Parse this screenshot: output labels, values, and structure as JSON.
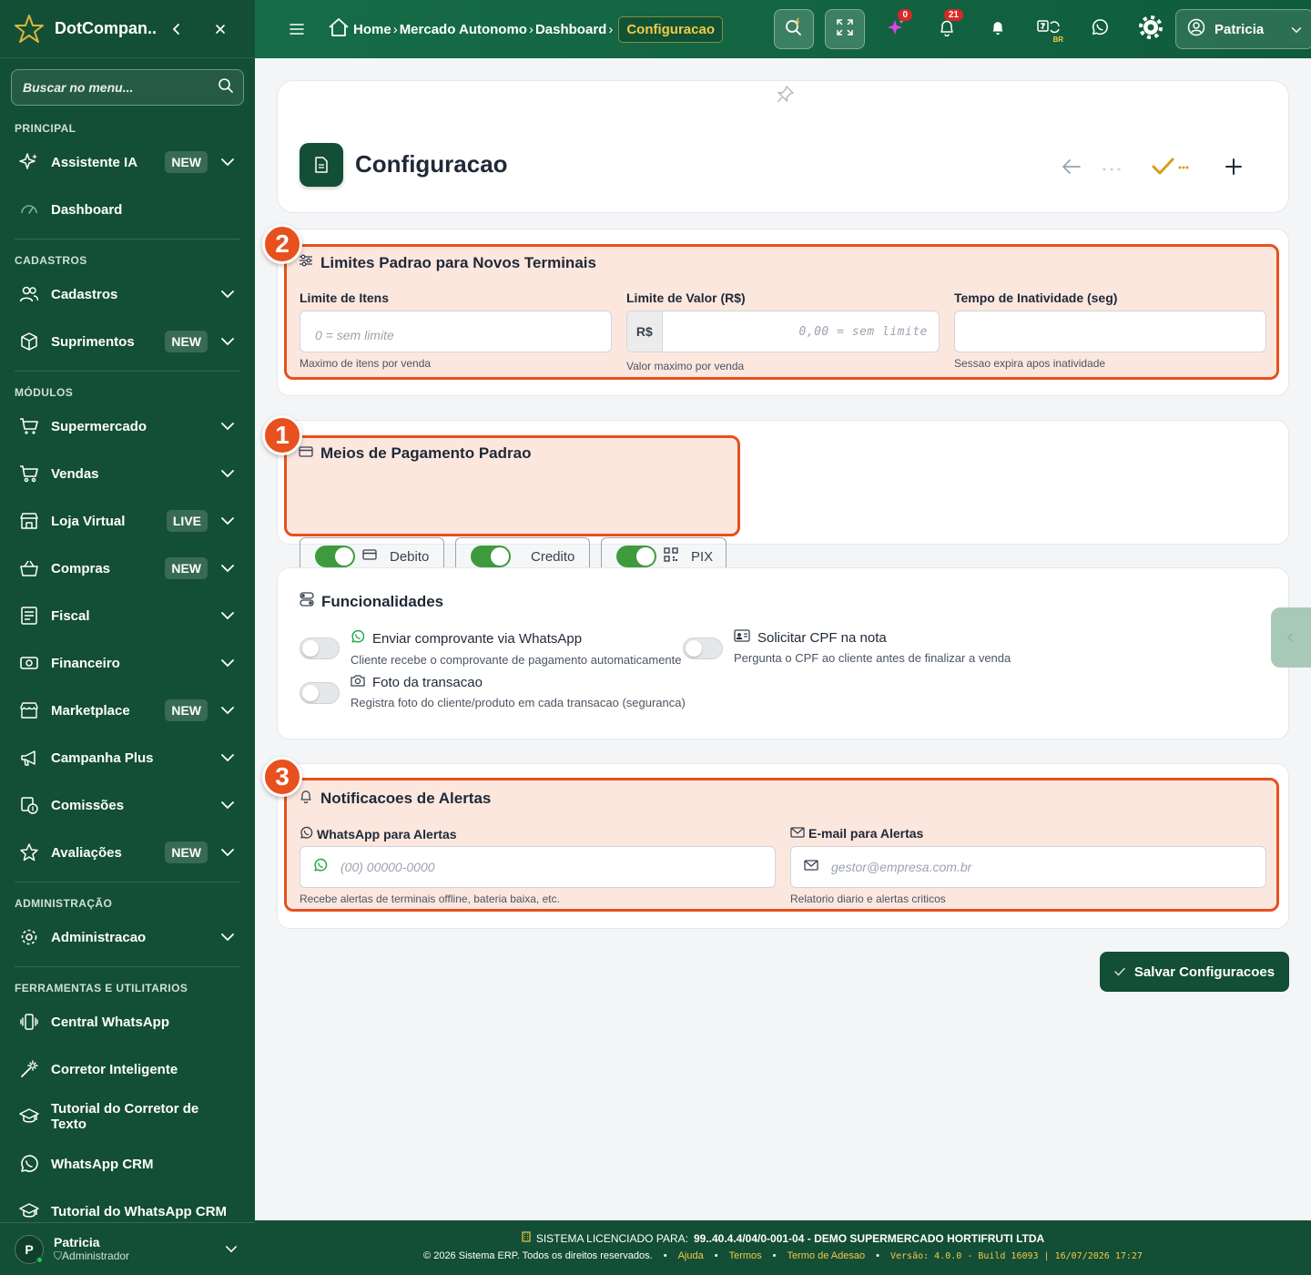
{
  "brand": {
    "name": "DotCompan..."
  },
  "sidebar": {
    "search_placeholder": "Buscar no menu...",
    "sections": {
      "principal": "PRINCIPAL",
      "cadastros": "CADASTROS",
      "modulos": "MÓDULOS",
      "administracao": "ADMINISTRAÇÃO",
      "ferramentas": "FERRAMENTAS E UTILITARIOS"
    },
    "items": {
      "assistente": {
        "label": "Assistente IA",
        "badge": "NEW"
      },
      "dashboard": {
        "label": "Dashboard"
      },
      "cadastros": {
        "label": "Cadastros"
      },
      "suprimentos": {
        "label": "Suprimentos",
        "badge": "NEW"
      },
      "supermercado": {
        "label": "Supermercado"
      },
      "vendas": {
        "label": "Vendas"
      },
      "loja": {
        "label": "Loja Virtual",
        "badge": "LIVE"
      },
      "compras": {
        "label": "Compras",
        "badge": "NEW"
      },
      "fiscal": {
        "label": "Fiscal"
      },
      "financeiro": {
        "label": "Financeiro"
      },
      "marketplace": {
        "label": "Marketplace",
        "badge": "NEW"
      },
      "campanha": {
        "label": "Campanha Plus"
      },
      "comissoes": {
        "label": "Comissões"
      },
      "avaliacoes": {
        "label": "Avaliações",
        "badge": "NEW"
      },
      "administracao": {
        "label": "Administracao"
      },
      "central_whatsapp": {
        "label": "Central WhatsApp"
      },
      "corretor": {
        "label": "Corretor Inteligente"
      },
      "tutorial_corretor": {
        "label": "Tutorial do Corretor de Texto"
      },
      "whatsapp_crm": {
        "label": "WhatsApp CRM"
      },
      "tutorial_whatsapp": {
        "label": "Tutorial do WhatsApp CRM"
      }
    },
    "user": {
      "initial": "P",
      "name": "Patricia",
      "role": "Administrador"
    }
  },
  "topbar": {
    "breadcrumb": [
      "Home",
      "Mercado Autonomo",
      "Dashboard",
      "Configuracao"
    ],
    "ai_badge": "0",
    "notif_badge": "21",
    "lang": "BR",
    "user": "Patricia"
  },
  "page": {
    "title": "Configuracao"
  },
  "limits": {
    "marker": "2",
    "title": "Limites Padrao para Novos Terminais",
    "items_label": "Limite de Itens",
    "items_placeholder": "0 = sem limite",
    "items_help": "Maximo de itens por venda",
    "value_label": "Limite de Valor (R$)",
    "value_prefix": "R$",
    "value_placeholder": "0,00 = sem limite",
    "value_help": "Valor maximo por venda",
    "idle_label": "Tempo de Inatividade (seg)",
    "idle_value": "",
    "idle_help": "Sessao expira apos inatividade"
  },
  "payments": {
    "marker": "1",
    "title": "Meios de Pagamento Padrao",
    "methods": [
      {
        "label": "Debito",
        "enabled": true
      },
      {
        "label": "Credito",
        "enabled": true
      },
      {
        "label": "PIX",
        "enabled": true
      }
    ]
  },
  "features": {
    "title": "Funcionalidades",
    "whatsapp": {
      "title": "Enviar comprovante via WhatsApp",
      "desc": "Cliente recebe o comprovante de pagamento automaticamente",
      "enabled": false
    },
    "cpf": {
      "title": "Solicitar CPF na nota",
      "desc": "Pergunta o CPF ao cliente antes de finalizar a venda",
      "enabled": false
    },
    "foto": {
      "title": "Foto da transacao",
      "desc": "Registra foto do cliente/produto em cada transacao (seguranca)",
      "enabled": false
    }
  },
  "alerts": {
    "marker": "3",
    "title": "Notificacoes de Alertas",
    "whatsapp_label": "WhatsApp para Alertas",
    "whatsapp_placeholder": "(00) 00000-0000",
    "whatsapp_help": "Recebe alertas de terminais offline, bateria baixa, etc.",
    "email_label": "E-mail para Alertas",
    "email_placeholder": "gestor@empresa.com.br",
    "email_help": "Relatorio diario e alertas criticos"
  },
  "save_label": "Salvar Configuracoes",
  "footer": {
    "license_label": "SISTEMA LICENCIADO PARA:",
    "license_value": "99..40.4.4/04/0-001-04 - DEMO SUPERMERCADO HORTIFRUTI LTDA",
    "copyright": "© 2026 Sistema ERP. Todos os direitos reservados.",
    "links": [
      "Ajuda",
      "Termos",
      "Termo de Adesao"
    ],
    "version": "Versão: 4.0.0 - Build 16093 | 16/07/2026 17:27"
  },
  "colors": {
    "primary": "#134e36",
    "accent": "#f6c945",
    "highlight": "#e8501d",
    "toggle_on": "#3e9a3c"
  }
}
